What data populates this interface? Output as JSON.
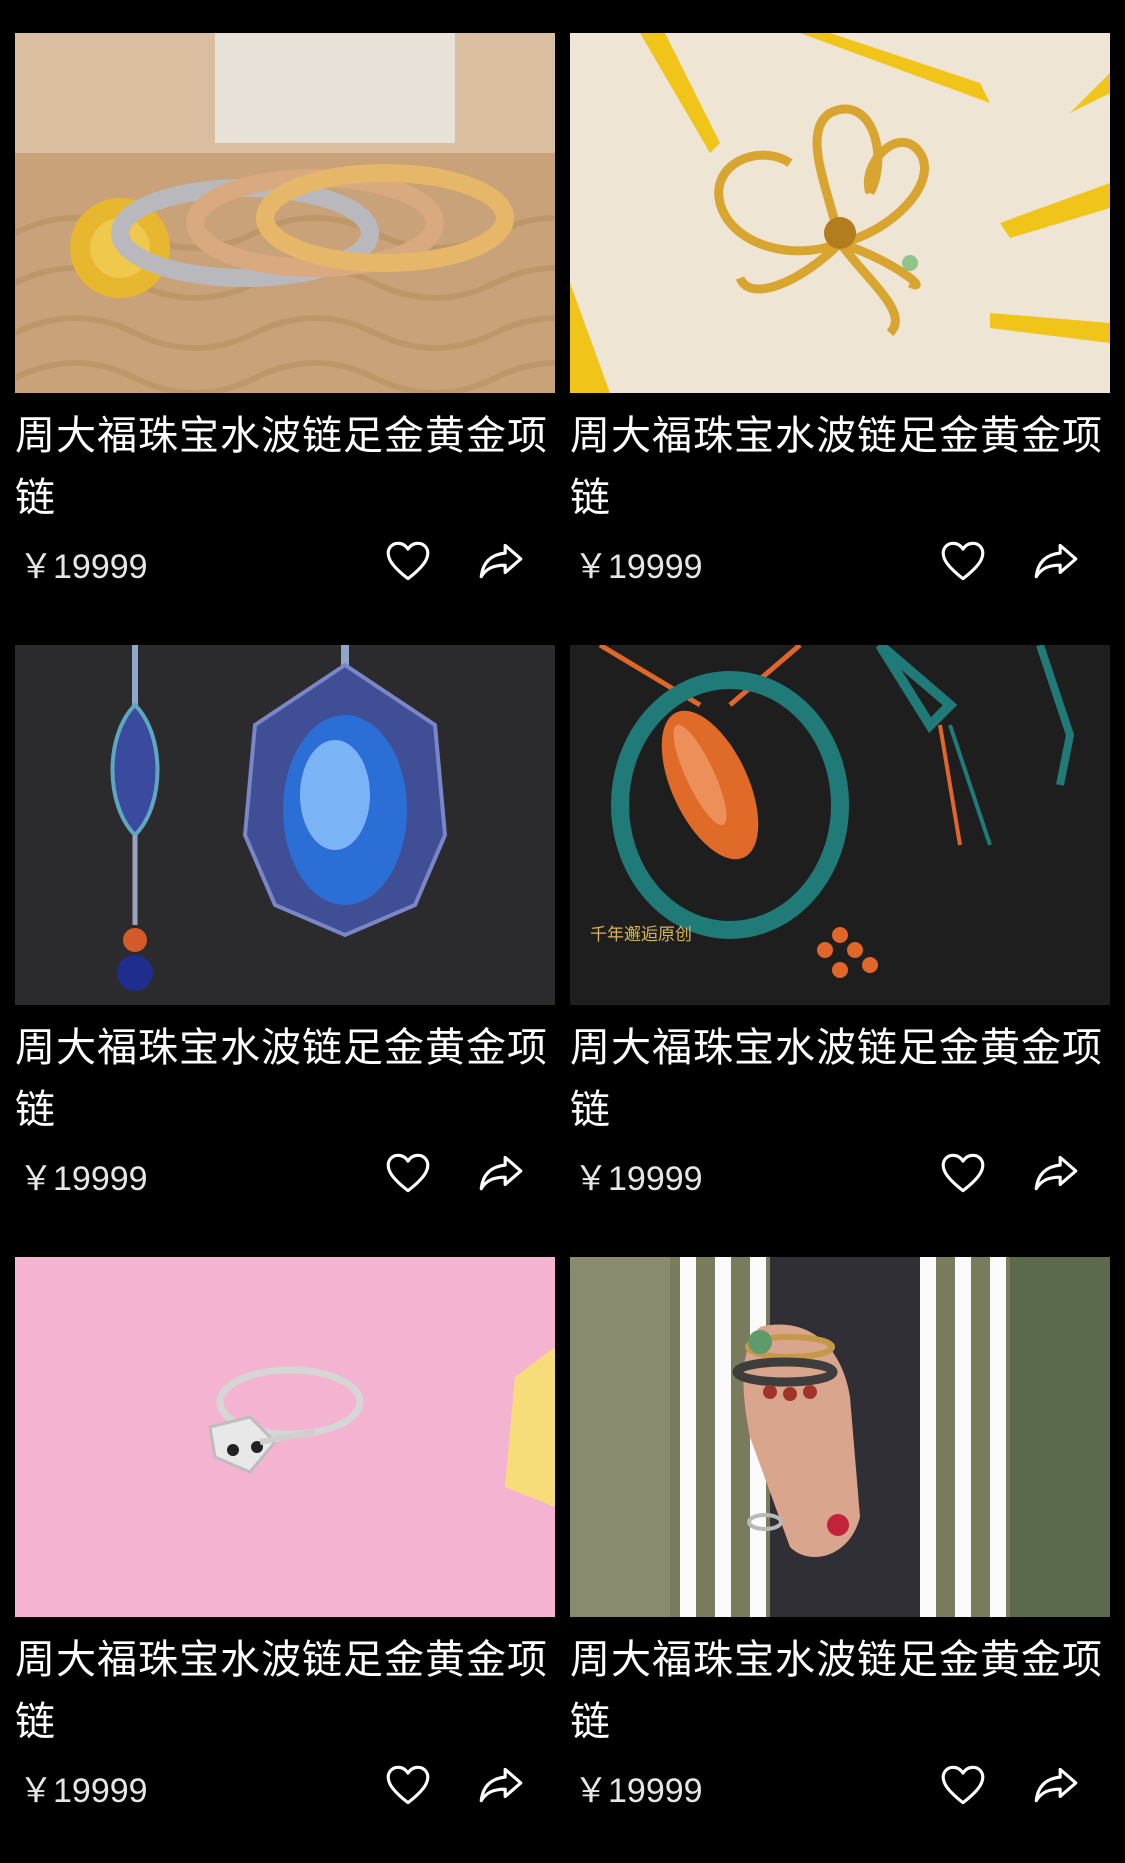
{
  "products": [
    {
      "title": "周大福珠宝水波链足金黄金项链",
      "price": "￥19999",
      "image": "gold bangles on woven mat"
    },
    {
      "title": "周大福珠宝水波链足金黄金项链",
      "price": "￥19999",
      "image": "gold flower brooch with yellow petals"
    },
    {
      "title": "周大福珠宝水波链足金黄金项链",
      "price": "￥19999",
      "image": "blue moonstone macrame pendant"
    },
    {
      "title": "周大福珠宝水波链足金黄金项链",
      "price": "￥19999",
      "image": "orange agate macrame necklace"
    },
    {
      "title": "周大福珠宝水波链足金黄金项链",
      "price": "￥19999",
      "image": "silver fox ring on pink background"
    },
    {
      "title": "周大福珠宝水波链足金黄金项链",
      "price": "￥19999",
      "image": "beaded bracelets on wrist"
    }
  ],
  "icons": {
    "like": "heart-outline-icon",
    "share": "share-arrow-icon"
  },
  "colors": {
    "background": "#000000",
    "text": "#ffffff",
    "price": "#e6e6e6"
  }
}
